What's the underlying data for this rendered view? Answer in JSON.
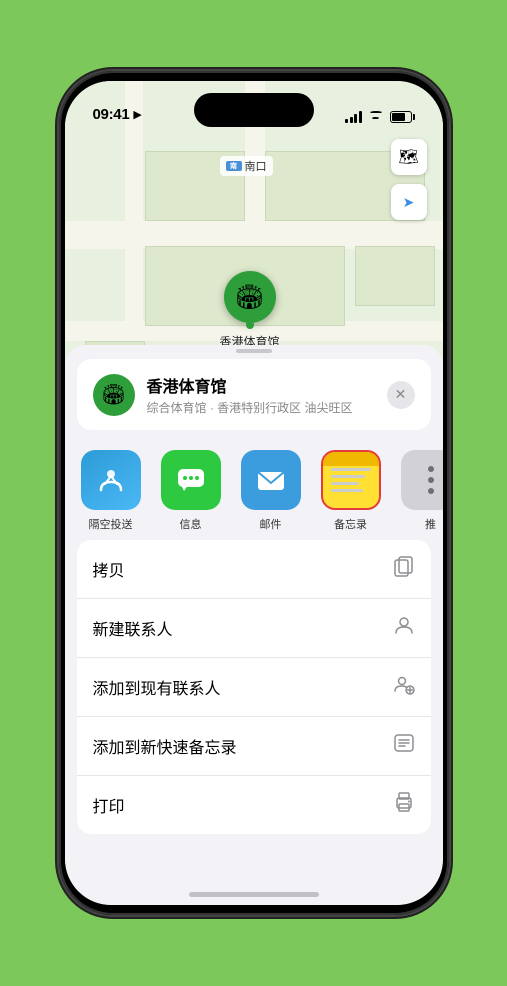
{
  "statusBar": {
    "time": "09:41",
    "locationArrow": "▶"
  },
  "map": {
    "label": "南口",
    "pinLabel": "香港体育馆",
    "controls": {
      "mapIcon": "🗺",
      "locationIcon": "➤"
    }
  },
  "venueCard": {
    "name": "香港体育馆",
    "subtitle": "综合体育馆 · 香港特别行政区 油尖旺区",
    "closeLabel": "✕"
  },
  "shareItems": [
    {
      "id": "airdrop",
      "label": "隔空投送",
      "type": "airdrop"
    },
    {
      "id": "messages",
      "label": "信息",
      "type": "messages"
    },
    {
      "id": "mail",
      "label": "邮件",
      "type": "mail"
    },
    {
      "id": "notes",
      "label": "备忘录",
      "type": "notes"
    },
    {
      "id": "more",
      "label": "推",
      "type": "more"
    }
  ],
  "actionItems": [
    {
      "id": "copy",
      "label": "拷贝",
      "icon": "⎘"
    },
    {
      "id": "new-contact",
      "label": "新建联系人",
      "icon": "👤"
    },
    {
      "id": "add-existing",
      "label": "添加到现有联系人",
      "icon": "👤"
    },
    {
      "id": "add-note",
      "label": "添加到新快速备忘录",
      "icon": "📝"
    },
    {
      "id": "print",
      "label": "打印",
      "icon": "🖨"
    }
  ]
}
